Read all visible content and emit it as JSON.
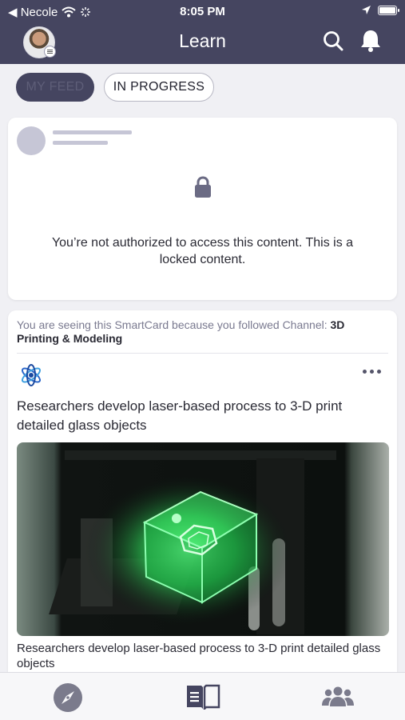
{
  "status_bar": {
    "back_label": "◀ Necole",
    "time": "8:05 PM"
  },
  "header": {
    "title": "Learn"
  },
  "filters": {
    "my_feed": "MY FEED",
    "in_progress": "IN PROGRESS",
    "active": "MY FEED"
  },
  "locked_card": {
    "message": "You’re not authorized to access this content. This is a locked content."
  },
  "article_card": {
    "reason_prefix": "You are seeing this SmartCard because you followed Channel: ",
    "channel_name": "3D Printing & Modeling",
    "title": "Researchers develop laser-based process to 3-D print detailed glass objects",
    "caption": "Researchers develop laser-based process to 3-D print detailed glass objects"
  },
  "bottom_nav": {
    "items": [
      "explore-icon",
      "learn-icon",
      "teams-icon"
    ],
    "active": "learn-icon"
  },
  "colors": {
    "header_bg": "#454560",
    "accent": "#454560",
    "image_glow": "#2fdc5a"
  }
}
